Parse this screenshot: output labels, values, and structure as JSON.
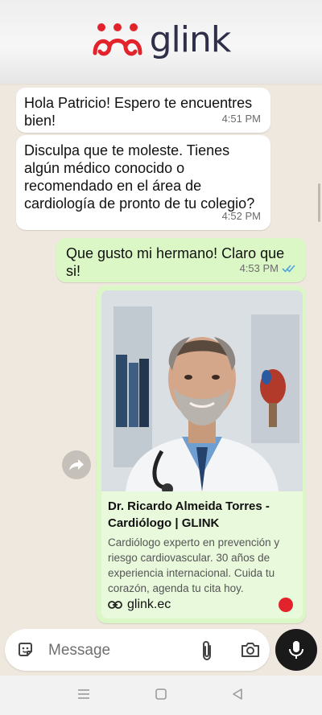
{
  "header": {
    "brand_name": "glink",
    "logo_color": "#e2232b"
  },
  "messages": [
    {
      "direction": "incoming",
      "text": "Hola Patricio! Espero te encuentres bien!",
      "time": "4:51 PM"
    },
    {
      "direction": "incoming",
      "text": "Disculpa que te moleste. Tienes algún médico conocido o recomendado en el área de cardiología de pronto de tu colegio?",
      "time": "4:52 PM"
    },
    {
      "direction": "outgoing",
      "text": "Que gusto mi hermano! Claro que si!",
      "time": "4:53 PM",
      "status": "read"
    }
  ],
  "link_card": {
    "title": "Dr. Ricardo Almeida Torres - Cardiólogo | GLINK",
    "description": "Cardiólogo experto en prevención y riesgo cardiovascular. 30 años de experiencia internacional. Cuida tu corazón, agenda tu cita hoy.",
    "domain": "glink.ec",
    "image": "doctor-portrait"
  },
  "composer": {
    "placeholder": "Message"
  },
  "colors": {
    "incoming_bubble": "#ffffff",
    "outgoing_bubble": "#dbf7c6",
    "read_ticks": "#4fa3e0"
  },
  "icons": [
    "sticker-icon",
    "paperclip-icon",
    "camera-icon",
    "microphone-icon",
    "forward-icon",
    "link-icon",
    "double-check-icon",
    "menu-nav-icon",
    "home-nav-icon",
    "back-nav-icon"
  ]
}
